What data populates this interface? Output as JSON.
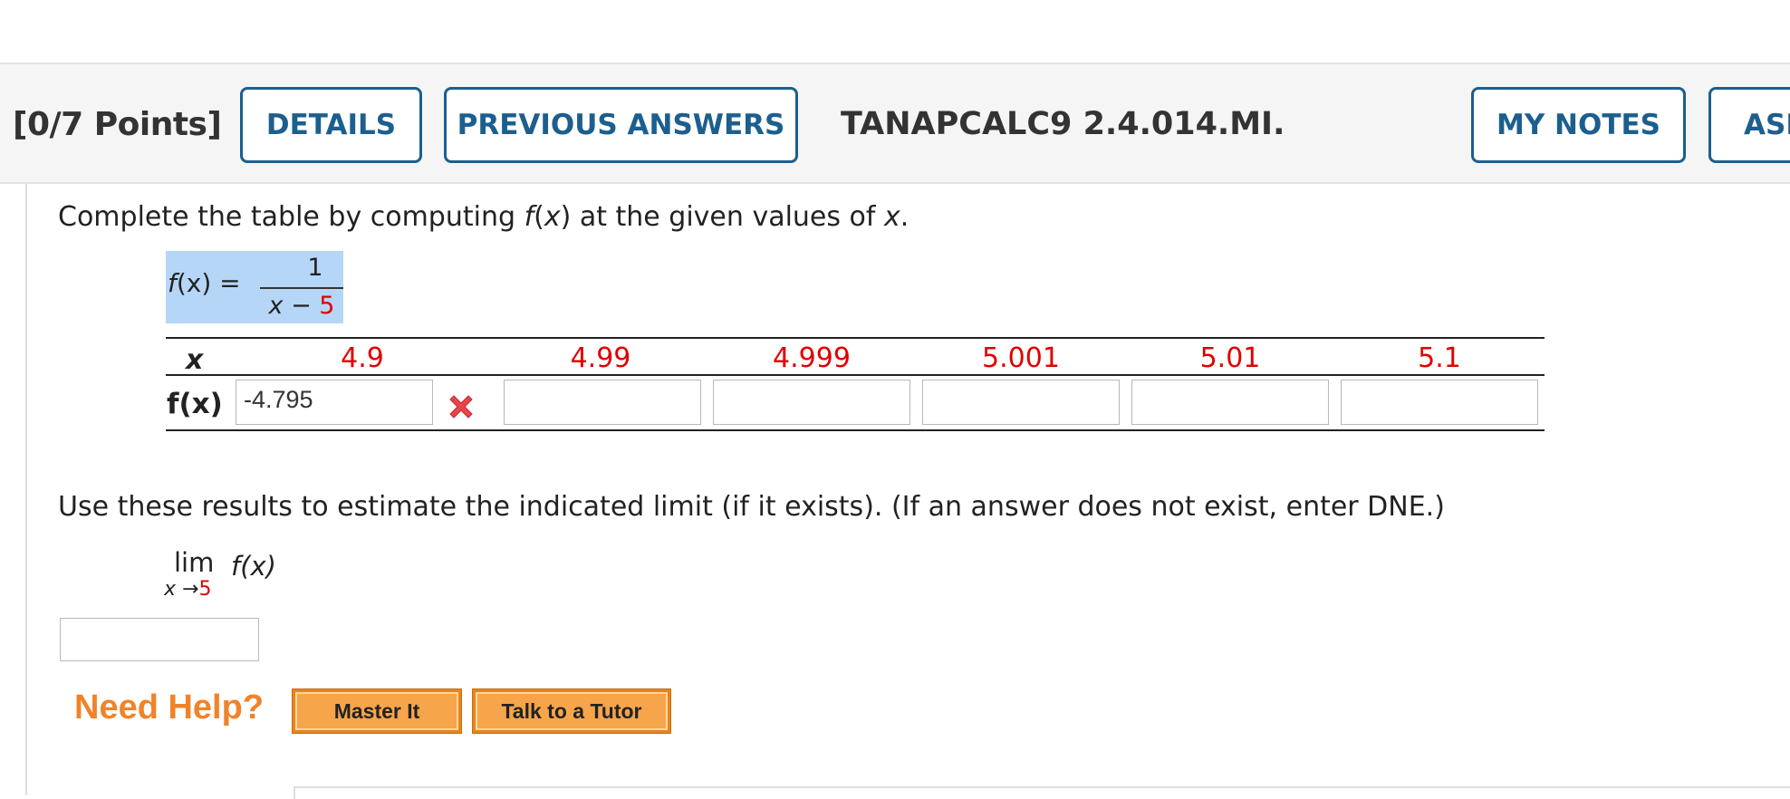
{
  "header": {
    "points": "[0/7 Points]",
    "details_label": "DETAILS",
    "previous_answers_label": "PREVIOUS ANSWERS",
    "question_id": "TANAPCALC9 2.4.014.MI.",
    "my_notes_label": "MY NOTES",
    "ask_label": "ASK"
  },
  "question": {
    "prompt_before": "Complete the table by computing ",
    "prompt_fx": "f",
    "prompt_mid": "(",
    "prompt_x1": "x",
    "prompt_after": ") at the given values of ",
    "prompt_x2": "x",
    "prompt_end": ".",
    "formula": {
      "lhs_f": "f",
      "lhs_rest": "(x) =",
      "numerator": "1",
      "denominator_var": "x −",
      "denominator_const": "5"
    }
  },
  "table": {
    "x_header": "x",
    "fx_header": "f(x)",
    "x_values": [
      "4.9",
      "4.99",
      "4.999",
      "5.001",
      "5.01",
      "5.1"
    ],
    "fx_inputs": [
      "-4.795",
      "",
      "",
      "",
      "",
      ""
    ],
    "first_answer_status": "incorrect"
  },
  "limit": {
    "prompt": "Use these results to estimate the indicated limit (if it exists). (If an answer does not exist, enter DNE.)",
    "lim": "lim",
    "sub_var": "x →",
    "sub_val": "5",
    "fx": "f(x)",
    "answer": ""
  },
  "help": {
    "label": "Need Help?",
    "master_it": "Master It",
    "talk_to_tutor": "Talk to a Tutor"
  },
  "colors": {
    "accent_blue": "#1c5f8f",
    "highlight": "#b6d6f7",
    "given_value_red": "#e00000",
    "help_orange": "#f0832a"
  }
}
